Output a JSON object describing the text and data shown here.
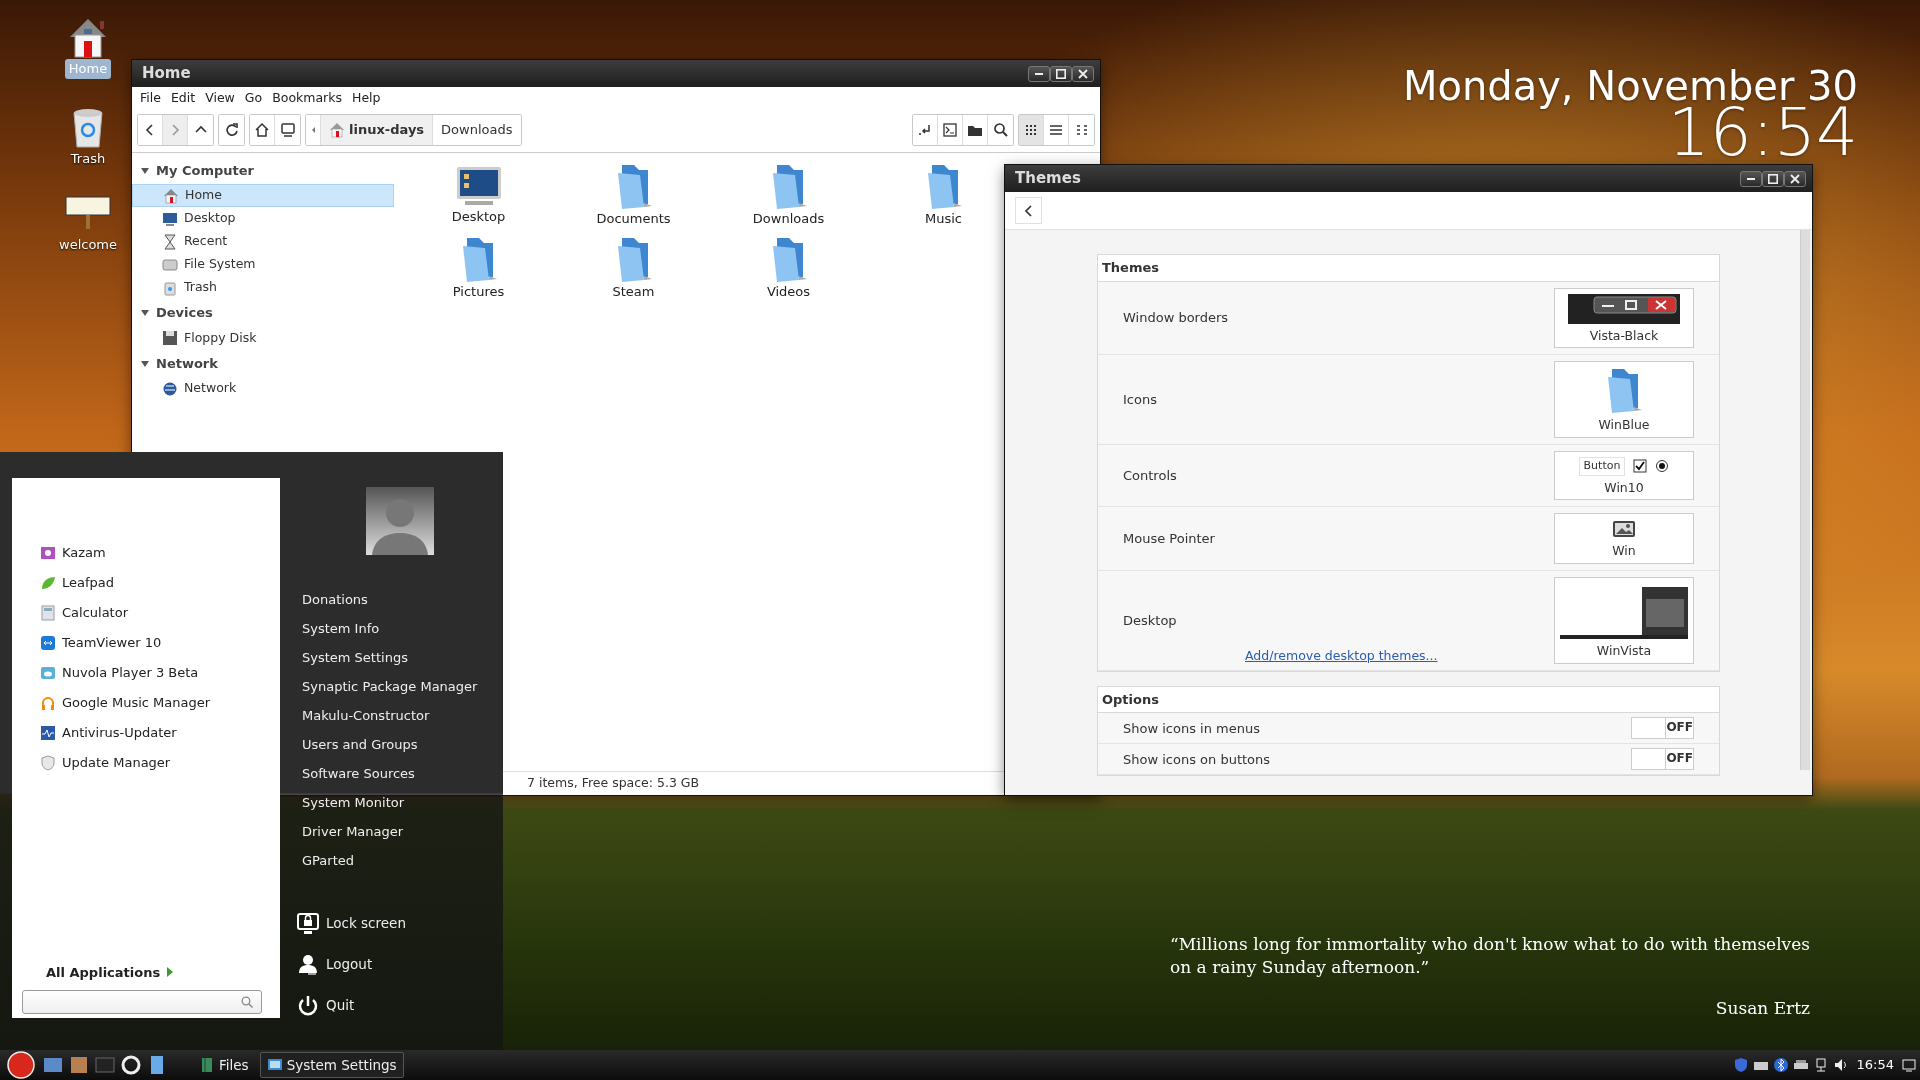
{
  "desktop_icons": [
    {
      "label": "Home",
      "kind": "home",
      "selected": true
    },
    {
      "label": "Trash",
      "kind": "trash",
      "selected": false
    },
    {
      "label": "welcome",
      "kind": "sign",
      "selected": false
    }
  ],
  "clock": {
    "date": "Monday, November 30",
    "time": "16:54"
  },
  "quote": {
    "text": "“Millions long for immortality who don't know what to do with themselves on a rainy Sunday afternoon.”",
    "author": "Susan Ertz"
  },
  "file_manager": {
    "title": "Home",
    "menu": [
      "File",
      "Edit",
      "View",
      "Go",
      "Bookmarks",
      "Help"
    ],
    "nav_buttons": [
      {
        "kind": "back",
        "disabled": false
      },
      {
        "kind": "forward",
        "disabled": true
      },
      {
        "kind": "up",
        "disabled": false
      }
    ],
    "path": [
      {
        "label": "linux-days",
        "selected": true
      },
      {
        "label": "Downloads",
        "selected": false
      }
    ],
    "view_modes": [
      {
        "kind": "icons",
        "selected": true
      },
      {
        "kind": "list",
        "selected": false
      },
      {
        "kind": "compact",
        "selected": false
      }
    ],
    "sidebar": [
      {
        "label": "My Computer",
        "expanded": true,
        "children": [
          {
            "label": "Home",
            "kind": "home",
            "selected": true
          },
          {
            "label": "Desktop",
            "kind": "desktop",
            "selected": false
          },
          {
            "label": "Recent",
            "kind": "recent",
            "selected": false
          },
          {
            "label": "File System",
            "kind": "drive",
            "selected": false
          },
          {
            "label": "Trash",
            "kind": "trash",
            "selected": false
          }
        ]
      },
      {
        "label": "Devices",
        "expanded": true,
        "children": [
          {
            "label": "Floppy Disk",
            "kind": "floppy",
            "selected": false
          }
        ]
      },
      {
        "label": "Network",
        "expanded": true,
        "children": [
          {
            "label": "Network",
            "kind": "network",
            "selected": false
          }
        ]
      }
    ],
    "items": [
      {
        "label": "Desktop",
        "kind": "desktop"
      },
      {
        "label": "Documents",
        "kind": "folder"
      },
      {
        "label": "Downloads",
        "kind": "folder"
      },
      {
        "label": "Music",
        "kind": "folder"
      },
      {
        "label": "Pictures",
        "kind": "folder"
      },
      {
        "label": "Steam",
        "kind": "folder"
      },
      {
        "label": "Videos",
        "kind": "folder"
      }
    ],
    "status": "7 items, Free space: 5.3 GB"
  },
  "themes_window": {
    "title": "Themes",
    "sections": [
      {
        "title": "Themes",
        "rows": [
          {
            "label": "Window borders",
            "kind": "borders",
            "value": "Vista-Black"
          },
          {
            "label": "Icons",
            "kind": "icons",
            "value": "WinBlue"
          },
          {
            "label": "Controls",
            "kind": "controls",
            "value": "Win10",
            "preview_button": "Button"
          },
          {
            "label": "Mouse Pointer",
            "kind": "pointer",
            "value": "Win"
          },
          {
            "label": "Desktop",
            "kind": "desktop",
            "value": "WinVista",
            "link": "Add/remove desktop themes..."
          }
        ]
      },
      {
        "title": "Options",
        "rows": [
          {
            "label": "Show icons in menus",
            "kind": "switch",
            "on": false,
            "state": "OFF"
          },
          {
            "label": "Show icons on buttons",
            "kind": "switch",
            "on": false,
            "state": "OFF"
          }
        ]
      }
    ]
  },
  "start_menu": {
    "apps": [
      {
        "label": "Kazam",
        "kind": "kazam"
      },
      {
        "label": "Leafpad",
        "kind": "leafpad"
      },
      {
        "label": "Calculator",
        "kind": "calculator"
      },
      {
        "label": "TeamViewer 10",
        "kind": "teamviewer"
      },
      {
        "label": "Nuvola Player 3 Beta",
        "kind": "nuvola"
      },
      {
        "label": "Google Music Manager",
        "kind": "headphones"
      },
      {
        "label": "Antivirus-Updater",
        "kind": "antivirus"
      },
      {
        "label": "Update Manager",
        "kind": "shield"
      }
    ],
    "all_apps": "All Applications",
    "places": [
      "Donations",
      "System Info",
      "System Settings",
      "Synaptic Package Manager",
      "Makulu-Constructor",
      "Users and Groups",
      "Software Sources",
      "System Monitor",
      "Driver Manager",
      "GParted"
    ],
    "session": [
      {
        "label": "Lock screen",
        "kind": "lock"
      },
      {
        "label": "Logout",
        "kind": "logout"
      },
      {
        "label": "Quit",
        "kind": "quit"
      }
    ]
  },
  "taskbar": {
    "tasks": [
      {
        "label": "Files",
        "kind": "files",
        "selected": false
      },
      {
        "label": "System Settings",
        "kind": "settings",
        "selected": true
      }
    ],
    "time": "16:54"
  }
}
